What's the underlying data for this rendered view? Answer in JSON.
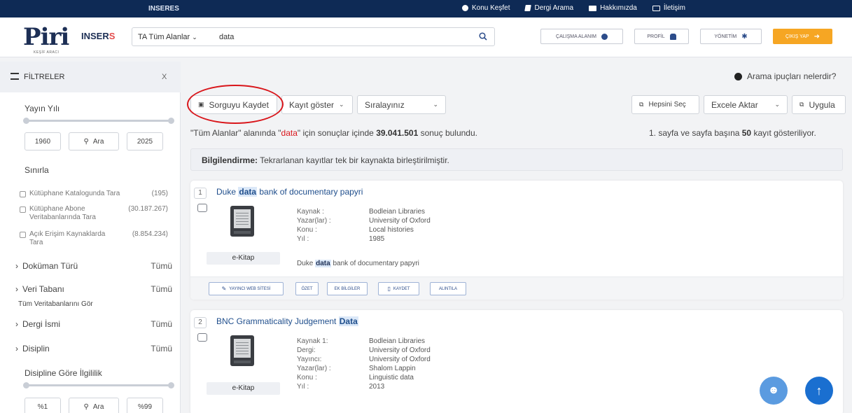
{
  "topbar": {
    "brand": "INSERES",
    "nav": [
      {
        "label": "Konu Keşfet",
        "icon": "compass-icon"
      },
      {
        "label": "Dergi Arama",
        "icon": "book-icon"
      },
      {
        "label": "Hakkımızda",
        "icon": "id-card-icon"
      },
      {
        "label": "İletişim",
        "icon": "mail-icon"
      }
    ]
  },
  "header": {
    "logo": "Piri",
    "logo_sub": "KEŞİF ARACI",
    "brand": "INSER",
    "brand_mark": "S",
    "search": {
      "scope": "TA Tüm Alanlar",
      "value": "data"
    },
    "buttons": {
      "workspace": "ÇALIŞMA ALANIM",
      "profile": "PROFİL",
      "admin": "YÖNETİM",
      "exit": "ÇIKIŞ YAP"
    }
  },
  "sidebar": {
    "title": "FİLTRELER",
    "close": "X",
    "year_label": "Yayın Yılı",
    "year_from": "1960",
    "year_to": "2025",
    "year_search": "Ara",
    "limit_label": "Sınırla",
    "limits": [
      {
        "label": "Kütüphane Katalogunda Tara",
        "count": "(195)"
      },
      {
        "label": "Kütüphane Abone Veritabanlarında Tara",
        "count": "(30.187.267)"
      },
      {
        "label": "Açık Erişim Kaynaklarda Tara",
        "count": "(8.854.234)"
      }
    ],
    "facets": [
      {
        "label": "Doküman Türü",
        "value": "Tümü"
      },
      {
        "label": "Veri Tabanı",
        "value": "Tümü"
      },
      {
        "label": "Dergi İsmi",
        "value": "Tümü"
      },
      {
        "label": "Disiplin",
        "value": "Tümü"
      }
    ],
    "all_db_link": "Tüm Veritabanlarını Gör",
    "relevance_label": "Disipline Göre İlgililik",
    "rel_from": "%1",
    "rel_to": "%99",
    "rel_search": "Ara"
  },
  "toolbar": {
    "tips": "Arama ipuçları nelerdir?",
    "save_query": "Sorguyu Kaydet",
    "show_records": "Kayıt göster",
    "sort": "Sıralayınız",
    "select_all": "Hepsini Seç",
    "export": "Excele Aktar",
    "apply": "Uygula"
  },
  "summary": {
    "pre": "\"Tüm Alanlar\" alanında \"",
    "query": "data",
    "mid": "\" için sonuçlar içinde ",
    "count": "39.041.501",
    "post": " sonuç bulundu.",
    "page_pre": "1. sayfa ve sayfa başına ",
    "page_size": "50",
    "page_post": " kayıt gösteriliyor."
  },
  "info": {
    "bold": "Bilgilendirme:",
    "text": " Tekrarlanan kayıtlar tek bir kaynakta birleştirilmiştir."
  },
  "results": [
    {
      "num": "1",
      "title_pre": "Duke ",
      "title_hl": "data",
      "title_post": " bank of documentary papyri",
      "type": "e-Kitap",
      "meta": [
        {
          "k": "Kaynak :",
          "v": "Bodleian Libraries"
        },
        {
          "k": "Yazar(lar) :",
          "v": "University of Oxford"
        },
        {
          "k": "Konu :",
          "v": "Local histories"
        },
        {
          "k": "Yıl :",
          "v": "1985"
        }
      ],
      "desc_pre": "Duke ",
      "desc_hl": "data",
      "desc_post": " bank of documentary papyri",
      "actions": [
        "YAYINCI WEB SİTESİ",
        "ÖZET",
        "EK BİLGİLER",
        "KAYDET",
        "ALINTILA"
      ]
    },
    {
      "num": "2",
      "title_pre": "BNC Grammaticality Judgement ",
      "title_hl": "Data",
      "type": "e-Kitap",
      "meta": [
        {
          "k": "Kaynak 1:",
          "v": "Bodleian Libraries"
        },
        {
          "k": "Dergi:",
          "v": "University of Oxford"
        },
        {
          "k": "Yayıncı:",
          "v": "University of Oxford"
        },
        {
          "k": "Yazar(lar) :",
          "v": "Shalom Lappin"
        },
        {
          "k": "Konu :",
          "v": "Linguistic data"
        },
        {
          "k": "Yıl :",
          "v": "2013"
        }
      ]
    }
  ],
  "colors": {
    "navy": "#0e2a55",
    "accent": "#f6a623",
    "highlight_circle": "#d9161b",
    "link": "#1f4e8c",
    "fab_support": "#5b9be0",
    "fab_top": "#1a6fd0"
  }
}
